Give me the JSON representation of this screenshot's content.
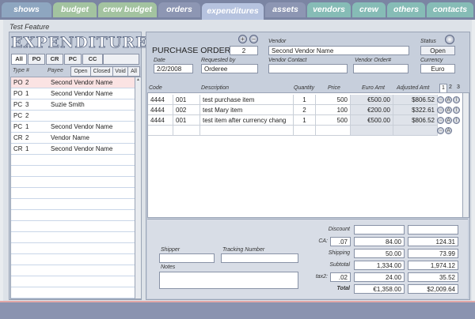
{
  "nav": {
    "tabs": [
      {
        "label": "shows",
        "color": "#8ea6c0"
      },
      {
        "label": "budget",
        "color": "#a3c3a0"
      },
      {
        "label": "crew budget",
        "color": "#a3c3a0"
      },
      {
        "label": "orders",
        "color": "#8d96b3"
      },
      {
        "label": "expenditures",
        "color": "#b6c3df"
      },
      {
        "label": "assets",
        "color": "#8d96b3"
      },
      {
        "label": "vendors",
        "color": "#86bcb6"
      },
      {
        "label": "crew",
        "color": "#86bcb6"
      },
      {
        "label": "others",
        "color": "#86bcb6"
      },
      {
        "label": "contacts",
        "color": "#86bcb6"
      }
    ]
  },
  "feature": "Test Feature",
  "left": {
    "logo": "EXPENDITURES",
    "filter_tabs": [
      "All",
      "PO",
      "CR",
      "PC",
      "CC"
    ],
    "col_type": "Type  #",
    "col_payee": "Payee",
    "status_filters": [
      "Open",
      "Closed",
      "Void",
      "All"
    ],
    "rows": [
      {
        "type": "PO",
        "num": "2",
        "payee": "Second Vendor Name"
      },
      {
        "type": "PO",
        "num": "1",
        "payee": "Second Vendor Name"
      },
      {
        "type": "PC",
        "num": "3",
        "payee": "Suzie Smith"
      },
      {
        "type": "PC",
        "num": "2",
        "payee": ""
      },
      {
        "type": "PC",
        "num": "1",
        "payee": "Second Vendor Name"
      },
      {
        "type": "CR",
        "num": "2",
        "payee": "Vendor Name"
      },
      {
        "type": "CR",
        "num": "1",
        "payee": "Second Vendor Name"
      }
    ]
  },
  "header": {
    "doc_type": "PURCHASE ORDER",
    "doc_num": "2",
    "vendor_label": "Vendor",
    "vendor": "Second Vendor Name",
    "status_label": "Status",
    "status": "Open",
    "date_label": "Date",
    "date": "2/2/2008",
    "requested_label": "Requested by",
    "requested_by": "Orderee",
    "vendor_contact_label": "Vendor Contact",
    "vendor_contact": "",
    "vendor_order_label": "Vendor Order#",
    "vendor_order": "",
    "currency_label": "Currency",
    "currency": "Euro"
  },
  "items": {
    "headers": {
      "code": "Code",
      "description": "Description",
      "quantity": "Quantity",
      "price": "Price",
      "euro": "Euro Amt",
      "adjusted": "Adjusted Amt"
    },
    "pages": [
      "1",
      "2",
      "3"
    ],
    "rows": [
      {
        "code": "4444",
        "sub": "001",
        "description": "test purchase item",
        "quantity": "1",
        "price": "500",
        "euro": "€500.00",
        "adjusted": "$806.52"
      },
      {
        "code": "4444",
        "sub": "002",
        "description": "test Mary item",
        "quantity": "2",
        "price": "100",
        "euro": "€200.00",
        "adjusted": "$322.61"
      },
      {
        "code": "4444",
        "sub": "001",
        "description": "test item after currency chang",
        "quantity": "1",
        "price": "500",
        "euro": "€500.00",
        "adjusted": "$806.52"
      }
    ]
  },
  "shipping": {
    "shipper_label": "Shipper",
    "shipper": "",
    "tracking_label": "Tracking  Number",
    "tracking": "",
    "notes_label": "Notes",
    "notes": ""
  },
  "totals": {
    "discount_label": "Discount",
    "discount_euro": "",
    "discount_adj": "",
    "ca_label": "CA:",
    "ca_rate": ".07",
    "ca_euro": "84.00",
    "ca_adj": "124.31",
    "shipping_label": "Shipping",
    "shipping_euro": "50.00",
    "shipping_adj": "73.99",
    "subtotal_label": "Subtotal",
    "subtotal_euro": "1,334.00",
    "subtotal_adj": "1,974.12",
    "tax2_label": "tax2:",
    "tax2_rate": ".02",
    "tax2_euro": "24.00",
    "tax2_adj": "35.52",
    "total_label": "Total",
    "total_euro": "€1,358.00",
    "total_adj": "$2,009.64"
  }
}
